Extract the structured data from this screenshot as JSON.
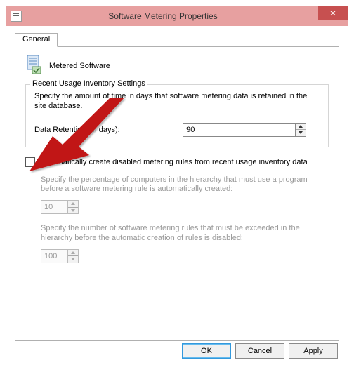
{
  "window": {
    "title": "Software Metering Properties",
    "close_glyph": "✕"
  },
  "tabs": {
    "general": "General"
  },
  "header": {
    "label": "Metered Software"
  },
  "group": {
    "title": "Recent Usage Inventory Settings",
    "desc": "Specify the amount of time in days that software metering data is retained in the site database.",
    "retention_label": "Data Retention (in days):",
    "retention_value": "90"
  },
  "auto": {
    "checkbox_label": "Automatically create disabled metering rules from recent usage inventory data",
    "percent_desc": "Specify the percentage of computers in the hierarchy that must use a program before a software metering rule is automatically created:",
    "percent_value": "10",
    "max_desc": "Specify the number of software metering rules that must be exceeded in the hierarchy before the automatic creation of rules is disabled:",
    "max_value": "100"
  },
  "buttons": {
    "ok": "OK",
    "cancel": "Cancel",
    "apply": "Apply"
  }
}
